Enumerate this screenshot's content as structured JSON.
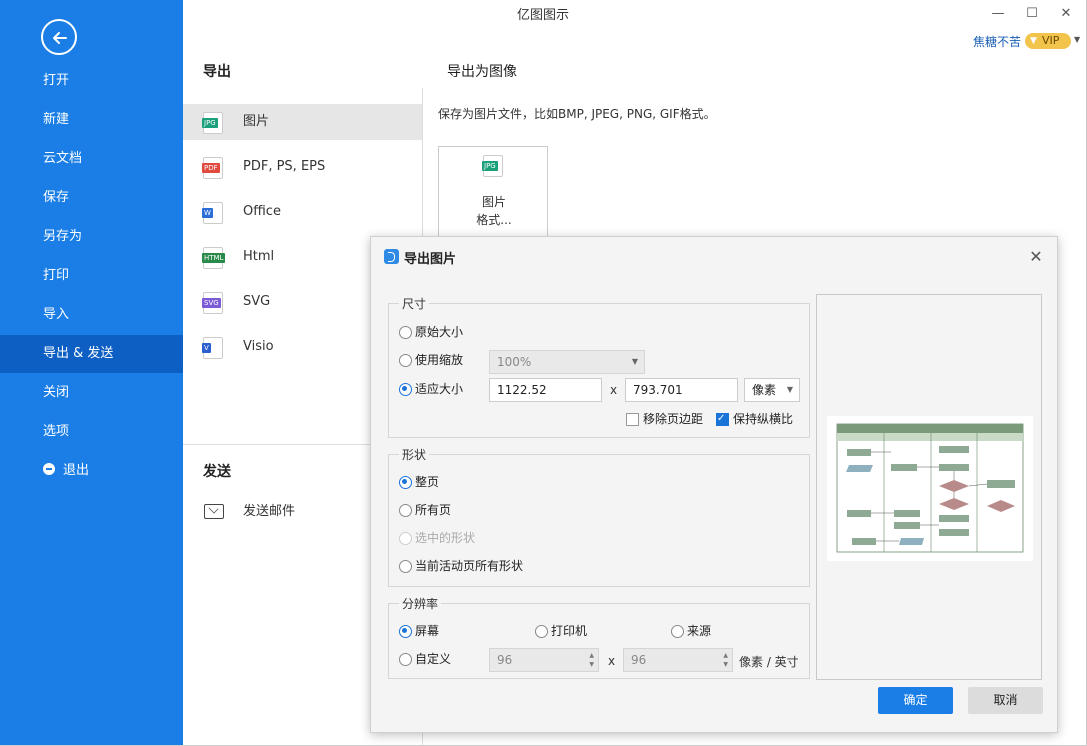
{
  "app": {
    "title": "亿图图示",
    "user_name": "焦糖不苦",
    "vip_label": "VIP"
  },
  "sidebar": {
    "items": [
      {
        "label": "打开"
      },
      {
        "label": "新建"
      },
      {
        "label": "云文档"
      },
      {
        "label": "保存"
      },
      {
        "label": "另存为"
      },
      {
        "label": "打印"
      },
      {
        "label": "导入"
      },
      {
        "label": "导出 & 发送",
        "active": true
      },
      {
        "label": "关闭"
      },
      {
        "label": "选项"
      },
      {
        "label": "退出"
      }
    ]
  },
  "export_panel": {
    "header": "导出",
    "formats": [
      {
        "label": "图片",
        "icon": "JPG",
        "color": "#1aa07a",
        "active": true
      },
      {
        "label": "PDF, PS, EPS",
        "icon": "PDF",
        "color": "#e04a3f"
      },
      {
        "label": "Office",
        "icon": "W",
        "color": "#2b6cd6"
      },
      {
        "label": "Html",
        "icon": "HTML",
        "color": "#2a8a4a"
      },
      {
        "label": "SVG",
        "icon": "SVG",
        "color": "#7b5bd6"
      },
      {
        "label": "Visio",
        "icon": "V",
        "color": "#2b5fd0"
      }
    ],
    "send_header": "发送",
    "send_mail": "发送邮件"
  },
  "image_panel": {
    "header": "导出为图像",
    "description": "保存为图片文件，比如BMP, JPEG, PNG, GIF格式。",
    "card_icon": "JPG",
    "card_line1": "图片",
    "card_line2": "格式..."
  },
  "dialog": {
    "title": "导出图片",
    "size_group": {
      "title": "尺寸",
      "original": "原始大小",
      "use_zoom": "使用缩放",
      "zoom_value": "100%",
      "fit_size": "适应大小",
      "width": "1122.52",
      "height": "793.701",
      "times": "x",
      "unit": "像素",
      "remove_margin": "移除页边距",
      "keep_ratio": "保持纵横比"
    },
    "shape_group": {
      "title": "形状",
      "whole_page": "整页",
      "all_pages": "所有页",
      "selected_shapes": "选中的形状",
      "active_page_shapes": "当前活动页所有形状"
    },
    "resolution_group": {
      "title": "分辨率",
      "screen": "屏幕",
      "printer": "打印机",
      "source": "来源",
      "custom": "自定义",
      "dpi_x": "96",
      "dpi_y": "96",
      "times": "x",
      "unit": "像素 / 英寸"
    },
    "ok": "确定",
    "cancel": "取消"
  },
  "colors": {
    "sidebar": "#1a7ee6",
    "sidebar_active": "#0e5fc4",
    "accent": "#1a73d9",
    "vip": "#f2c44c"
  }
}
